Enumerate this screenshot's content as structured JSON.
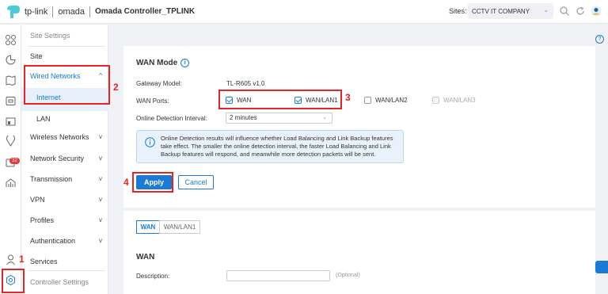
{
  "header": {
    "logo_text": "tp-link",
    "product": "omada",
    "title": "Omada Controller_TPLINK",
    "sites_label": "Sites:",
    "site_value": "CCTV IT COMPANY"
  },
  "rail": {
    "badge": "32"
  },
  "menu": {
    "header": "Site Settings",
    "items": [
      {
        "label": "Site"
      },
      {
        "label": "Wired Networks",
        "chev": "^"
      },
      {
        "label": "Internet"
      },
      {
        "label": "LAN"
      },
      {
        "label": "Wireless Networks",
        "chev": "v"
      },
      {
        "label": "Network Security",
        "chev": "v"
      },
      {
        "label": "Transmission",
        "chev": "v"
      },
      {
        "label": "VPN",
        "chev": "v"
      },
      {
        "label": "Profiles",
        "chev": "v"
      },
      {
        "label": "Authentication",
        "chev": "v"
      },
      {
        "label": "Services"
      },
      {
        "label": "Controller Settings"
      }
    ]
  },
  "wan_mode": {
    "title": "WAN Mode",
    "gateway_label": "Gateway Model:",
    "gateway_value": "TL-R605 v1.0",
    "ports_label": "WAN Ports:",
    "ports": [
      {
        "label": "WAN",
        "state": "checked"
      },
      {
        "label": "WAN/LAN1",
        "state": "checked"
      },
      {
        "label": "WAN/LAN2",
        "state": "empty"
      },
      {
        "label": "WAN/LAN3",
        "state": "disabled"
      }
    ],
    "interval_label": "Online Detection Interval:",
    "interval_value": "2 minutes",
    "note_lines": [
      "Online Detection results will influence whether Load Balancing and Link Backup features",
      "take effect. The smaller the online detection interval, the faster Load Balancing and Link",
      "Backup features will respond, and meanwhile more detection packets will be sent."
    ],
    "apply": "Apply",
    "cancel": "Cancel"
  },
  "wan_section": {
    "tabs": [
      "WAN",
      "WAN/LAN1"
    ],
    "title": "WAN",
    "desc_label": "Description:",
    "desc_hint": "(Optional)"
  },
  "annotations": [
    "1",
    "2",
    "3",
    "4"
  ],
  "colors": {
    "accent": "#1a7bd6",
    "annotation": "#e52525"
  }
}
